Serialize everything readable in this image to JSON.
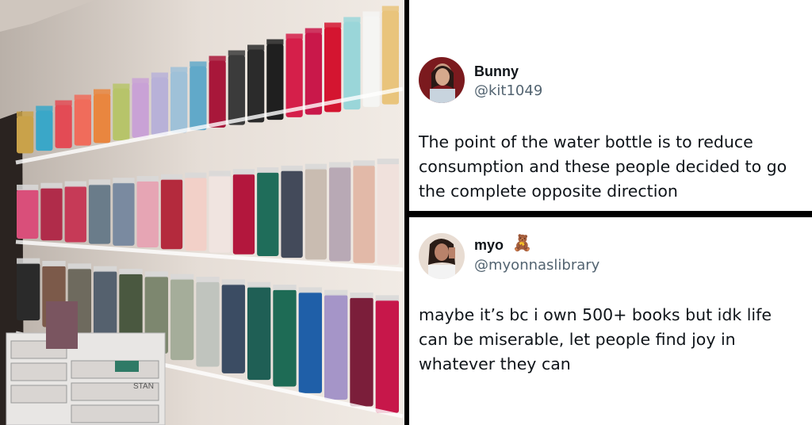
{
  "photo": {
    "subject": "tumbler-shelves-photo",
    "shelf_label": "STAN"
  },
  "tweet1": {
    "name": "Bunny",
    "handle": "@kit1049",
    "text": "The point of the water bottle is to reduce consumption and these people decided to go the complete opposite direction"
  },
  "tweet2": {
    "name": "myo",
    "badge_icon": "teddy-bear-icon",
    "badge_emoji": "🧸",
    "handle": "@myonnaslibrary",
    "text": "maybe it’s bc i own 500+ books but idk life can be miserable, let people find joy in whatever they can"
  }
}
